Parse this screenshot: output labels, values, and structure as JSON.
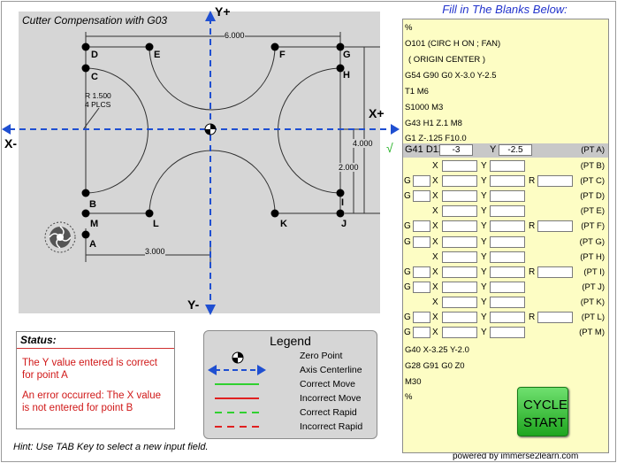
{
  "drawing": {
    "title": "Cutter Compensation with G03",
    "axes": {
      "y_plus": "Y+",
      "y_minus": "Y-",
      "x_plus": "X+",
      "x_minus": "X-"
    },
    "dimensions": {
      "top_width": "6.000",
      "right_height": "4.000",
      "right_inner": "2.000",
      "bottom_width": "3.000",
      "radius_line1": "R 1.500",
      "radius_line2": "4 PLCS"
    },
    "points": {
      "A": "A",
      "B": "B",
      "C": "C",
      "D": "D",
      "E": "E",
      "F": "F",
      "G": "G",
      "H": "H",
      "I": "I",
      "J": "J",
      "K": "K",
      "L": "L",
      "M": "M"
    }
  },
  "status": {
    "title": "Status:",
    "message_1": "The Y value entered is correct for point A",
    "message_2": "An error occurred: The X value is not entered for point B"
  },
  "legend": {
    "title": "Legend",
    "items": [
      {
        "label": "Zero Point",
        "icon": "zero-point-icon"
      },
      {
        "label": "Axis Centerline",
        "icon": "axis-arrow-icon",
        "color": "#1f4fd1"
      },
      {
        "label": "Correct Move",
        "color": "#30d030"
      },
      {
        "label": "Incorrect Move",
        "color": "#e02020"
      },
      {
        "label": "Correct Rapid",
        "color": "#30d030"
      },
      {
        "label": "Incorrect Rapid",
        "color": "#e02020"
      }
    ]
  },
  "hint": "Hint: Use TAB Key to select a new input field.",
  "powered_by": "powered by immerse2learn.com",
  "program": {
    "heading": "Fill in The Blanks Below:",
    "pre_lines": [
      "%",
      "O101 (CIRC H ON ; FAN)",
      "( ORIGIN CENTER )",
      "G54 G90 G0 X-3.0 Y-2.5",
      "T1 M6",
      "S1000 M3",
      "G43 H1 Z.1 M8",
      "G1 Z-.125 F10.0"
    ],
    "row_a": {
      "prefix": "G41 D1X",
      "x_value": "-3",
      "y_label": "Y",
      "y_value": "-2.5",
      "point": "(PT A)"
    },
    "rows": [
      {
        "point": "(PT B)",
        "g": false,
        "r": false
      },
      {
        "point": "(PT C)",
        "g": true,
        "r": true
      },
      {
        "point": "(PT D)",
        "g": true,
        "r": false
      },
      {
        "point": "(PT E)",
        "g": false,
        "r": false
      },
      {
        "point": "(PT F)",
        "g": true,
        "r": true
      },
      {
        "point": "(PT G)",
        "g": true,
        "r": false
      },
      {
        "point": "(PT H)",
        "g": false,
        "r": false
      },
      {
        "point": "(PT I)",
        "g": true,
        "r": true
      },
      {
        "point": "(PT J)",
        "g": true,
        "r": false
      },
      {
        "point": "(PT K)",
        "g": false,
        "r": false
      },
      {
        "point": "(PT L)",
        "g": true,
        "r": true
      },
      {
        "point": "(PT M)",
        "g": true,
        "r": false
      }
    ],
    "labels": {
      "g": "G",
      "x": "X",
      "y": "Y",
      "r": "R"
    },
    "post_lines": [
      "G40 X-3.25 Y-2.0",
      "G28 G91 G0 Z0",
      "M30",
      "%"
    ],
    "check_mark": "√"
  },
  "cycle_start": {
    "line1": "CYCLE",
    "line2": "START"
  }
}
